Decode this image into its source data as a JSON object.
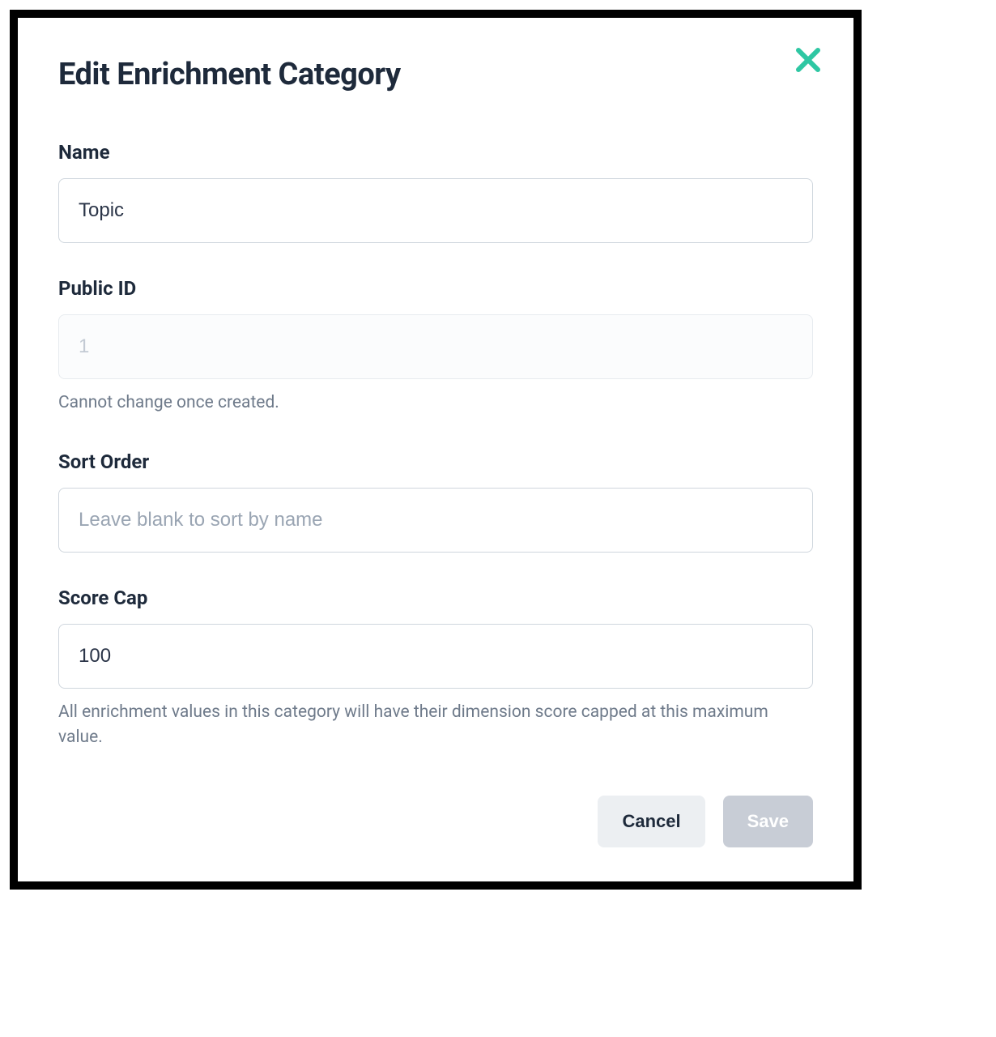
{
  "modal": {
    "title": "Edit Enrichment Category",
    "close_icon": "close-icon"
  },
  "form": {
    "name": {
      "label": "Name",
      "value": "Topic"
    },
    "public_id": {
      "label": "Public ID",
      "value": "1",
      "help": "Cannot change once created."
    },
    "sort_order": {
      "label": "Sort Order",
      "placeholder": "Leave blank to sort by name",
      "value": ""
    },
    "score_cap": {
      "label": "Score Cap",
      "value": "100",
      "help": "All enrichment values in this category will have their dimension score capped at this maximum value."
    }
  },
  "footer": {
    "cancel_label": "Cancel",
    "save_label": "Save"
  }
}
